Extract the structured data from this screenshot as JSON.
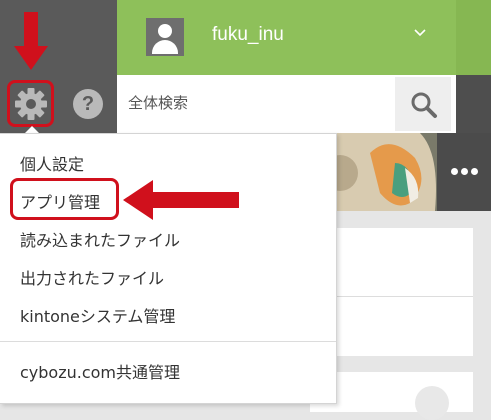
{
  "header": {
    "username": "fuku_inu"
  },
  "search": {
    "placeholder": "全体検索"
  },
  "settings_menu": {
    "items": [
      {
        "label": "個人設定"
      },
      {
        "label": "アプリ管理"
      },
      {
        "label": "読み込まれたファイル"
      },
      {
        "label": "出力されたファイル"
      },
      {
        "label": "kintoneシステム管理"
      },
      {
        "label": "cybozu.com共通管理"
      }
    ]
  },
  "icons": [
    "user-avatar-icon",
    "chevron-down-icon",
    "gear-icon",
    "help-icon",
    "search-icon",
    "more-dots-icon",
    "plus-icon"
  ],
  "annotations": {
    "highlight_color": "#d0101c"
  },
  "colors": {
    "header_green": "#8ec05a",
    "dark_gray": "#5a5a5a"
  }
}
